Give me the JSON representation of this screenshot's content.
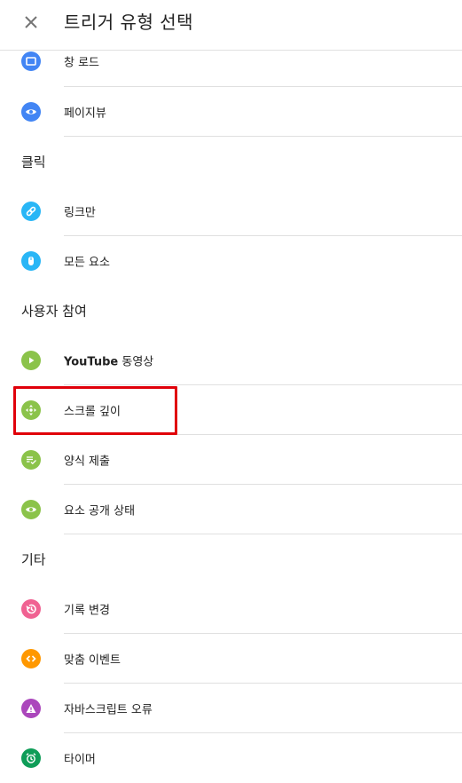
{
  "header": {
    "title": "트리거 유형 선택",
    "close_icon": "close-icon"
  },
  "colors": {
    "blue": "#4285f4",
    "lightblue": "#29b6f6",
    "green": "#8bc34a",
    "pink": "#f06292",
    "orange": "#ff9800",
    "purple": "#ab47bc",
    "teal": "#0f9d58",
    "highlight": "#e0000a"
  },
  "page_load": {
    "items": [
      {
        "label": "창 로드",
        "icon": "window-icon"
      },
      {
        "label": "페이지뷰",
        "icon": "eye-icon"
      }
    ]
  },
  "click": {
    "title": "클릭",
    "items": [
      {
        "label": "링크만",
        "icon": "link-icon"
      },
      {
        "label": "모든 요소",
        "icon": "mouse-icon"
      }
    ]
  },
  "engagement": {
    "title": "사용자 참여",
    "items": [
      {
        "label_bold": "YouTube",
        "label_rest": " 동영상",
        "icon": "play-icon"
      },
      {
        "label": "스크롤 깊이",
        "icon": "move-icon"
      },
      {
        "label": "양식 제출",
        "icon": "form-check-icon"
      },
      {
        "label": "요소 공개 상태",
        "icon": "eye-icon"
      }
    ]
  },
  "other": {
    "title": "기타",
    "items": [
      {
        "label": "기록 변경",
        "icon": "history-icon"
      },
      {
        "label": "맞춤 이벤트",
        "icon": "code-icon"
      },
      {
        "label": "자바스크립트 오류",
        "icon": "warning-icon"
      },
      {
        "label": "타이머",
        "icon": "alarm-icon"
      }
    ]
  }
}
